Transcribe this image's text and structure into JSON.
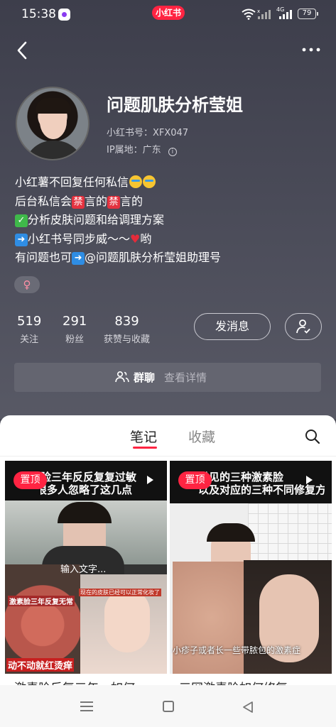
{
  "status_bar": {
    "time": "15:38",
    "brand": "小红书",
    "network": "4G",
    "battery": "79",
    "icons": [
      "notification-app-icon",
      "wifi-icon",
      "signal-icon",
      "battery-icon"
    ]
  },
  "nav": {
    "back_icon": "chevron-left-icon",
    "more_icon": "more-dots-icon"
  },
  "profile": {
    "nickname": "问题肌肤分析莹姐",
    "redbook_id": "小红书号：XFX047",
    "ip_location": "IP属地：广东",
    "ip_info_icon": "info-icon",
    "gender": "♀",
    "bio": {
      "line1": "小红薯不回复任何私信",
      "line2_a": "后台私信会",
      "line2_b": "禁",
      "line2_c": "言的",
      "line2_d": "禁",
      "line2_e": "言的",
      "line3": "分析皮肤问题和给调理方案",
      "line4_a": "小红书号同步威～～",
      "line4_b": "哟",
      "line5_a": "有问题也可",
      "line5_b": "@问题肌肤分析莹姐助理号"
    }
  },
  "stats": {
    "following": {
      "value": "519",
      "label": "关注"
    },
    "followers": {
      "value": "291",
      "label": "粉丝"
    },
    "likes": {
      "value": "839",
      "label": "获赞与收藏"
    }
  },
  "actions": {
    "message": "发消息",
    "friend_icon": "user-check-icon"
  },
  "group_chat": {
    "label": "群聊",
    "detail": "查看详情"
  },
  "tabs": {
    "notes": "笔记",
    "collections": "收藏"
  },
  "cards": [
    {
      "pin": "置顶",
      "title": "脸三年反反复复过敏",
      "subtitle": "很多人忽略了这几点",
      "caption1": "输入文字...",
      "caption2": "激素脸三年反复无常",
      "caption3": "现在的皮肤已经可以正常化妆了",
      "caption4": "动不动就红烫痒",
      "footer": "激素脸反复三年，如何"
    },
    {
      "pin": "置顶",
      "title": "常见的三种激素脸",
      "subtitle": "以及对应的三种不同修复方案",
      "caption1": "小疹子或者长一些带脓包的激素症",
      "footer": "三网激素脸如何修复"
    }
  ],
  "system_nav": {
    "menu_icon": "menu-icon",
    "home_icon": "home-icon",
    "back_icon": "back-triangle-icon"
  },
  "colors": {
    "accent": "#ff2442",
    "header_bg": "#4a4b56",
    "panel_bg": "#ffffff"
  }
}
